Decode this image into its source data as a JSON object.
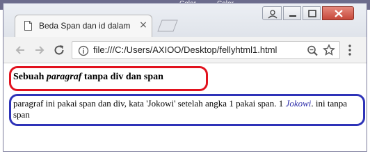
{
  "desktop": {
    "left_label": "Color",
    "right_label": "Color"
  },
  "browser": {
    "tab_title": "Beda Span dan id dalam",
    "tab_close": "×",
    "url": "file:///C:/Users/AXIOO/Desktop/fellyhtml1.html"
  },
  "page": {
    "p1_before": "Sebuah ",
    "p1_em": "paragraf",
    "p1_after": " tanpa div dan span",
    "p2_text": "paragraf ini pakai span dan div, kata 'Jokowi' setelah angka 1 pakai span. 1 ",
    "p2_span": "Jokowi",
    "p2_end": ". ini tanpa span"
  },
  "annotations": {
    "highlight_1": "#e2121e",
    "highlight_2": "#2e33b8"
  }
}
